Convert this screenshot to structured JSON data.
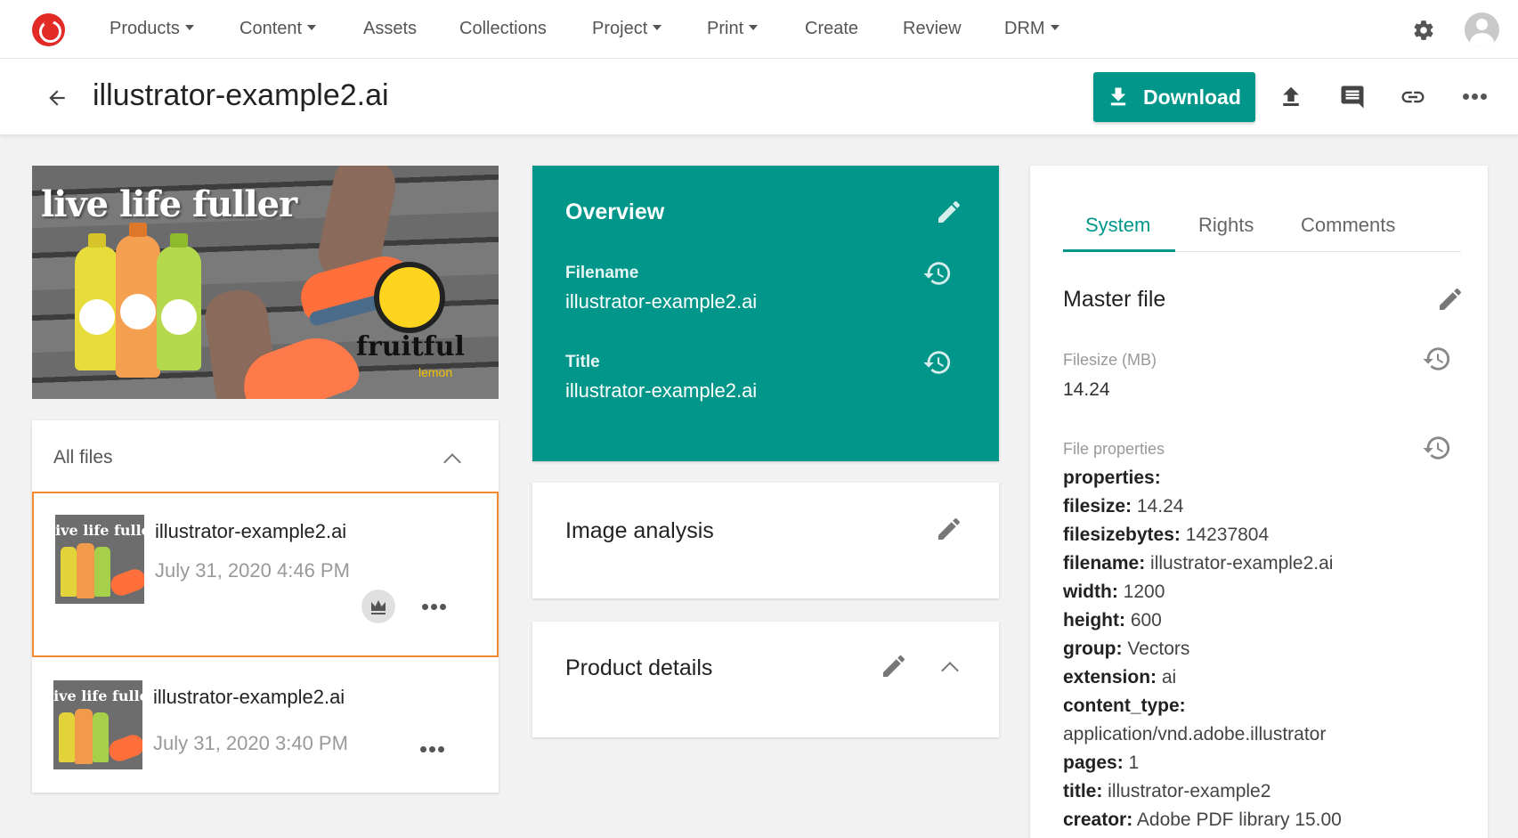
{
  "nav": {
    "items": [
      {
        "label": "Products",
        "dropdown": true
      },
      {
        "label": "Content",
        "dropdown": true
      },
      {
        "label": "Assets",
        "dropdown": false
      },
      {
        "label": "Collections",
        "dropdown": false
      },
      {
        "label": "Project",
        "dropdown": true
      },
      {
        "label": "Print",
        "dropdown": true
      },
      {
        "label": "Create",
        "dropdown": false
      },
      {
        "label": "Review",
        "dropdown": false
      },
      {
        "label": "DRM",
        "dropdown": true
      }
    ]
  },
  "header": {
    "title": "illustrator-example2.ai",
    "download_label": "Download"
  },
  "hero": {
    "headline": "live life fuller",
    "brand": "fruitful",
    "brand_sub": "lemon"
  },
  "files": {
    "title": "All files",
    "items": [
      {
        "name": "illustrator-example2.ai",
        "date": "July 31, 2020 4:46 PM",
        "selected": true,
        "master": true
      },
      {
        "name": "illustrator-example2.ai",
        "date": "July 31, 2020 3:40 PM",
        "selected": false,
        "master": false
      }
    ]
  },
  "overview": {
    "title": "Overview",
    "filename_label": "Filename",
    "filename_value": "illustrator-example2.ai",
    "title_label": "Title",
    "title_value": "illustrator-example2.ai"
  },
  "image_analysis": {
    "title": "Image analysis"
  },
  "product_details": {
    "title": "Product details"
  },
  "system": {
    "tabs": [
      "System",
      "Rights",
      "Comments"
    ],
    "active_tab": "System",
    "master_file_title": "Master file",
    "filesize_label": "Filesize (MB)",
    "filesize_value": "14.24",
    "file_props_label": "File properties",
    "props": [
      {
        "k": "properties:",
        "v": ""
      },
      {
        "k": "filesize:",
        "v": "14.24"
      },
      {
        "k": "filesizebytes:",
        "v": "14237804"
      },
      {
        "k": "filename:",
        "v": "illustrator-example2.ai"
      },
      {
        "k": "width:",
        "v": "1200"
      },
      {
        "k": "height:",
        "v": "600"
      },
      {
        "k": "group:",
        "v": "Vectors"
      },
      {
        "k": "extension:",
        "v": "ai"
      },
      {
        "k": "content_type:",
        "v": ""
      },
      {
        "k": "",
        "v": "application/vnd.adobe.illustrator"
      },
      {
        "k": "pages:",
        "v": "1"
      },
      {
        "k": "title:",
        "v": "illustrator-example2"
      },
      {
        "k": "creator:",
        "v": "Adobe PDF library 15.00"
      }
    ]
  },
  "colors": {
    "accent": "#00968a",
    "selected_border": "#f28a2f",
    "logo": "#e22a26"
  }
}
